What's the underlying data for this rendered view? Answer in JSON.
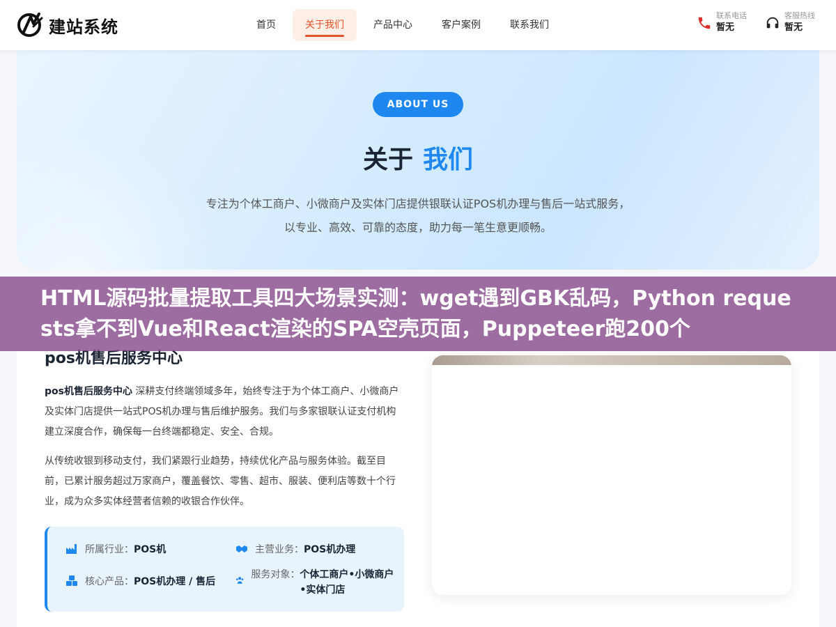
{
  "header": {
    "logo_text": "建站系统",
    "nav": [
      {
        "label": "首页"
      },
      {
        "label": "关于我们"
      },
      {
        "label": "产品中心"
      },
      {
        "label": "客户案例"
      },
      {
        "label": "联系我们"
      }
    ],
    "active_nav": "关于我们",
    "phone": {
      "label": "联系电话",
      "value": "暂无",
      "icon": "phone-icon"
    },
    "hotline": {
      "label": "客服热线",
      "value": "暂无",
      "icon": "headset-icon"
    }
  },
  "hero": {
    "badge": "ABOUT US",
    "title_a": "关于",
    "title_b": "我们",
    "desc_line1": "专注为个体工商户、小微商户及实体门店提供银联认证POS机办理与售后一站式服务，",
    "desc_line2": "以专业、高效、可靠的态度，助力每一笔生意更顺畅。"
  },
  "banner": {
    "text": "HTML源码批量提取工具四大场景实测：wget遇到GBK乱码，Python requests拿不到Vue和React渲染的SPA空壳页面，Puppeteer跑200个"
  },
  "about": {
    "title": "pos机售后服务中心",
    "p1_bold": "pos机售后服务中心",
    "p1_rest": " 深耕支付终端领域多年，始终专注于为个体工商户、小微商户及实体门店提供一站式POS机办理与售后维护服务。我们与多家银联认证支付机构建立深度合作，确保每一台终端都稳定、安全、合规。",
    "p2": "从传统收银到移动支付，我们紧跟行业趋势，持续优化产品与服务体验。截至目前，已累计服务超过万家商户，覆盖餐饮、零售、超市、服装、便利店等数十个行业，成为众多实体经营者信赖的收银合作伙伴。",
    "info": {
      "industry_k": "所属行业：",
      "industry_v": "POS机",
      "business_k": "主营业务：",
      "business_v": "POS机办理",
      "product_k": "核心产品：",
      "product_v": "POS机办理 / 售后",
      "target_k": "服务对象：",
      "target_v": "个体工商户•小微商户•实体门店"
    }
  },
  "colors": {
    "accent": "#1e88f0",
    "nav_active": "#e2532b",
    "banner": "#884c8c"
  }
}
